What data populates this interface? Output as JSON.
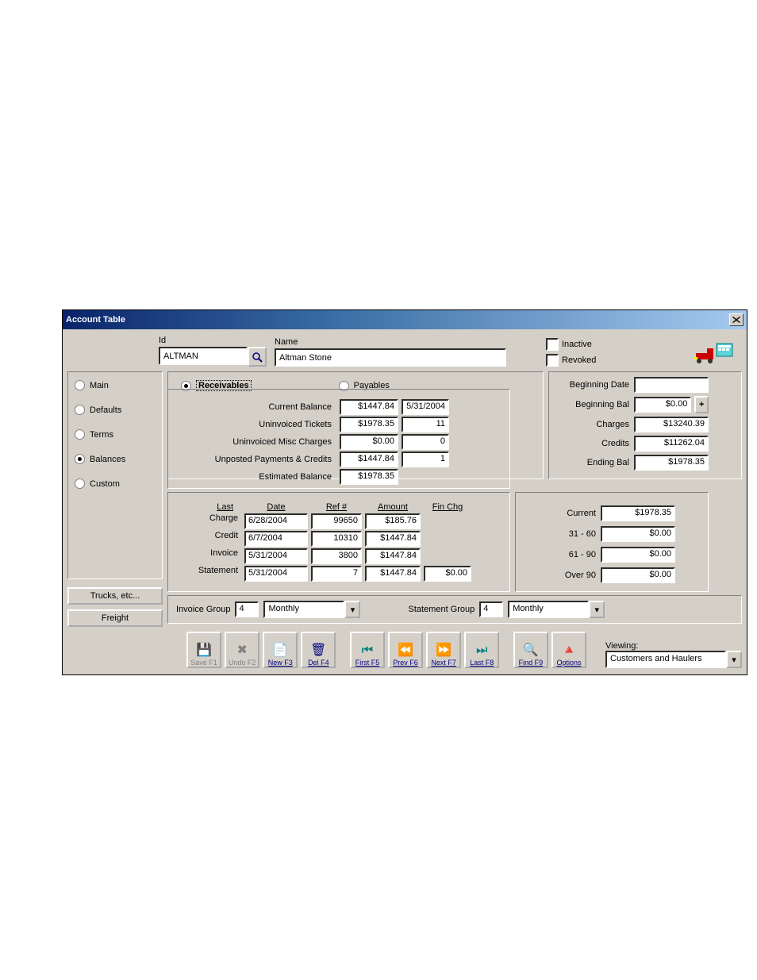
{
  "window": {
    "title": "Account Table"
  },
  "header": {
    "id_label": "Id",
    "id_value": "ALTMAN",
    "name_label": "Name",
    "name_value": "Altman Stone",
    "inactive_label": "Inactive",
    "revoked_label": "Revoked"
  },
  "sidebar": {
    "items": [
      "Main",
      "Defaults",
      "Terms",
      "Balances",
      "Custom"
    ],
    "selected": 3,
    "trucks_btn": "Trucks, etc...",
    "freight_btn": "Freight"
  },
  "tabs": {
    "receivables": "Receivables",
    "payables": "Payables"
  },
  "balances": {
    "rows": [
      {
        "label": "Current Balance",
        "v1": "$1447.84",
        "v2": "5/31/2004"
      },
      {
        "label": "Uninvoiced Tickets",
        "v1": "$1978.35",
        "v2": "11"
      },
      {
        "label": "Uninvoiced Misc Charges",
        "v1": "$0.00",
        "v2": "0"
      },
      {
        "label": "Unposted Payments & Credits",
        "v1": "$1447.84",
        "v2": "1"
      },
      {
        "label": "Estimated Balance",
        "v1": "$1978.35",
        "v2": ""
      }
    ]
  },
  "summary": {
    "begin_date_label": "Beginning Date",
    "begin_date": "",
    "begin_bal_label": "Beginning Bal",
    "begin_bal": "$0.00",
    "charges_label": "Charges",
    "charges": "$13240.39",
    "credits_label": "Credits",
    "credits": "$11262.04",
    "ending_label": "Ending Bal",
    "ending": "$1978.35"
  },
  "last": {
    "hdr": {
      "last": "Last",
      "date": "Date",
      "ref": "Ref #",
      "amount": "Amount",
      "fin": "Fin Chg"
    },
    "rows": [
      {
        "label": "Charge",
        "date": "6/28/2004",
        "ref": "99650",
        "amount": "$185.76",
        "fin": ""
      },
      {
        "label": "Credit",
        "date": "6/7/2004",
        "ref": "10310",
        "amount": "$1447.84",
        "fin": ""
      },
      {
        "label": "Invoice",
        "date": "5/31/2004",
        "ref": "3800",
        "amount": "$1447.84",
        "fin": ""
      },
      {
        "label": "Statement",
        "date": "5/31/2004",
        "ref": "7",
        "amount": "$1447.84",
        "fin": "$0.00"
      }
    ]
  },
  "aging": {
    "current_label": "Current",
    "current": "$1978.35",
    "r31_label": "31 - 60",
    "r31": "$0.00",
    "r61_label": "61 - 90",
    "r61": "$0.00",
    "over_label": "Over 90",
    "over": "$0.00"
  },
  "groups": {
    "invoice_label": "Invoice Group",
    "invoice_num": "4",
    "invoice_sel": "Monthly",
    "statement_label": "Statement Group",
    "statement_num": "4",
    "statement_sel": "Monthly"
  },
  "toolbar": {
    "save": "Save F1",
    "undo": "Undo F2",
    "new": "New F3",
    "del": "Del F4",
    "first": "First F5",
    "prev": "Prev F6",
    "next": "Next F7",
    "last": "Last F8",
    "find": "Find F9",
    "options": "Options",
    "viewing_label": "Viewing:",
    "viewing_value": "Customers and Haulers"
  }
}
